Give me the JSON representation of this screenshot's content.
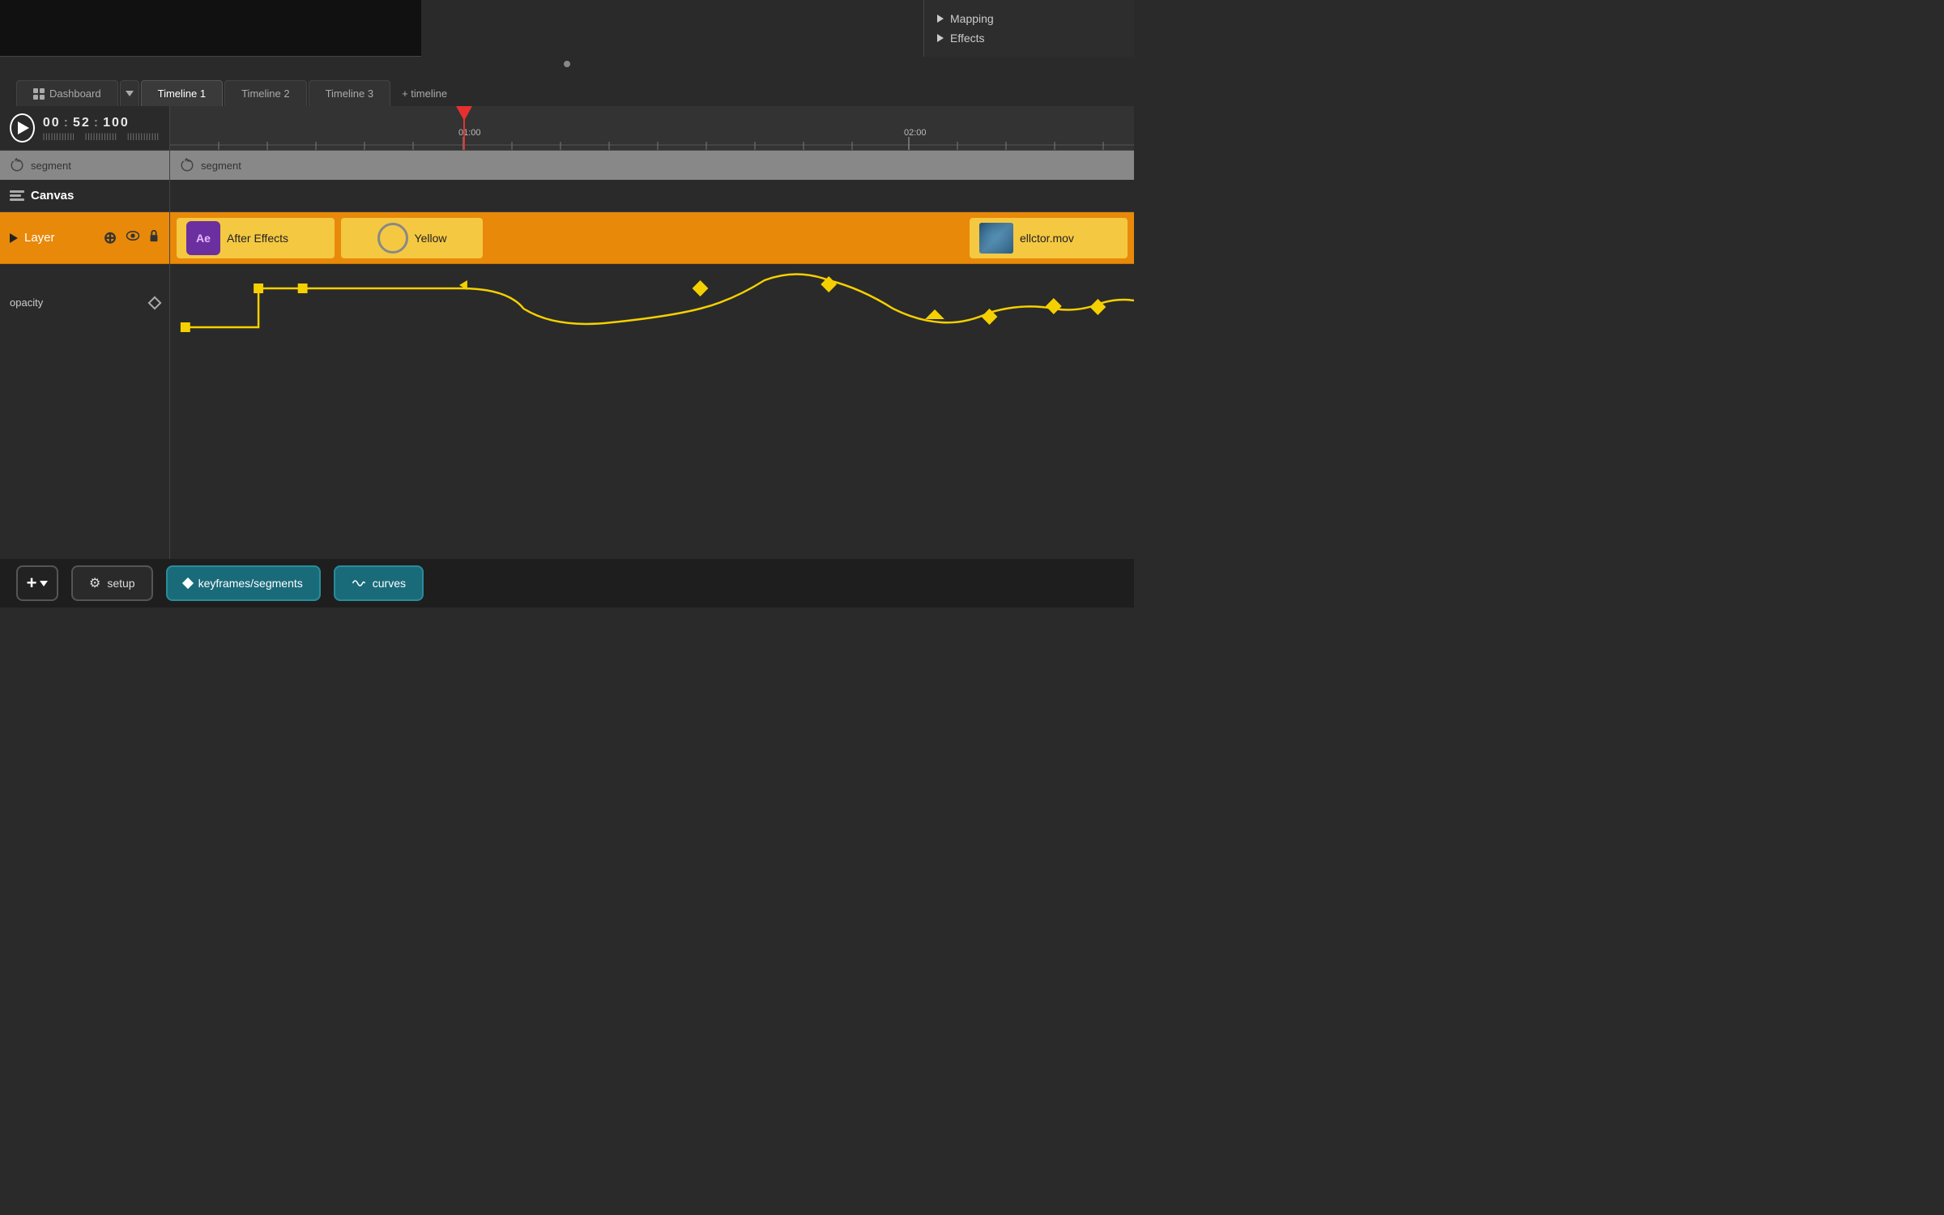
{
  "preview": {
    "visible": true
  },
  "right_panel": {
    "items": [
      {
        "label": "Mapping"
      },
      {
        "label": "Effects"
      }
    ]
  },
  "tabs": {
    "dashboard_label": "Dashboard",
    "dropdown_label": "▼",
    "items": [
      {
        "label": "Timeline 1",
        "active": true
      },
      {
        "label": "Timeline 2",
        "active": false
      },
      {
        "label": "Timeline 3",
        "active": false
      }
    ],
    "add_label": "+ timeline"
  },
  "transport": {
    "timecode": {
      "hours": "00",
      "minutes": "52",
      "frames": "100"
    }
  },
  "timeline": {
    "ruler": {
      "marks": [
        {
          "time": "01:00",
          "pos": 362
        },
        {
          "time": "02:00",
          "pos": 912
        }
      ]
    },
    "segment_label": "segment",
    "canvas_label": "Canvas",
    "layer_label": "Layer",
    "opacity_label": "opacity",
    "clips": [
      {
        "type": "ae",
        "label": "After Effects"
      },
      {
        "type": "yellow",
        "label": "Yellow"
      },
      {
        "type": "mov",
        "label": "ellctor.mov"
      }
    ]
  },
  "toolbar": {
    "setup_label": "setup",
    "keyframes_label": "keyframes/segments",
    "curves_label": "curves"
  }
}
